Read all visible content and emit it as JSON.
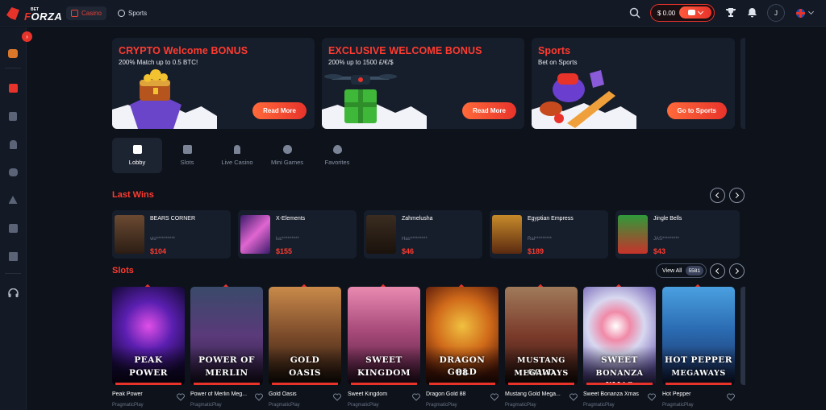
{
  "brand": {
    "bet": "BET",
    "name_a": "F",
    "name_b": "ORZA"
  },
  "nav": {
    "casino": "Casino",
    "sports": "Sports"
  },
  "header": {
    "balance": "$ 0.00",
    "avatar": "J"
  },
  "banners": [
    {
      "title": "CRYPTO Welcome BONUS",
      "subtitle": "200% Match up to 0.5 BTC!",
      "button": "Read More"
    },
    {
      "title": "EXCLUSIVE WELCOME BONUS",
      "subtitle": "200% up to 1500 £/€/$",
      "button": "Read More"
    },
    {
      "title": "Sports",
      "subtitle": "Bet on Sports",
      "button": "Go to Sports"
    }
  ],
  "categories": [
    "Lobby",
    "Slots",
    "Live Casino",
    "Mini Games",
    "Favorites"
  ],
  "last_wins": {
    "title": "Last Wins",
    "items": [
      {
        "game": "BEARS CORNER",
        "user": "vio**********",
        "amount": "$104"
      },
      {
        "game": "X-Elements",
        "user": "luc*********",
        "amount": "$155"
      },
      {
        "game": "Zahmelusha",
        "user": "Has*********",
        "amount": "$46"
      },
      {
        "game": "Egyptian Empress",
        "user": "Ral*********",
        "amount": "$189"
      },
      {
        "game": "Jingle Bells",
        "user": "JAS*********",
        "amount": "$43"
      }
    ]
  },
  "slots": {
    "title": "Slots",
    "view_all": "View All",
    "count": "5581",
    "items": [
      {
        "name": "Peak Power",
        "provider": "PragmaticPlay",
        "logo": [
          "PEAK",
          "POWER"
        ]
      },
      {
        "name": "Power of Merlin Meg...",
        "provider": "PragmaticPlay",
        "logo": [
          "POWER OF",
          "MERLIN"
        ]
      },
      {
        "name": "Gold Oasis",
        "provider": "PragmaticPlay",
        "logo": [
          "GOLD",
          "OASIS"
        ]
      },
      {
        "name": "Sweet Kingdom",
        "provider": "PragmaticPlay",
        "logo": [
          "SWEET",
          "KINGDOM"
        ]
      },
      {
        "name": "Dragon Gold 88",
        "provider": "PragmaticPlay",
        "logo": [
          "DRAGON GOLD",
          "88"
        ]
      },
      {
        "name": "Mustang Gold Mega...",
        "provider": "PragmaticPlay",
        "logo": [
          "MUSTANG GOLD",
          "MEGAWAYS"
        ]
      },
      {
        "name": "Sweet Bonanza Xmas",
        "provider": "PragmaticPlay",
        "logo": [
          "SWEET",
          "BONANZA XMAS"
        ]
      },
      {
        "name": "Hot Pepper",
        "provider": "PragmaticPlay",
        "logo": [
          "HOT PEPPER",
          "MEGAWAYS"
        ]
      }
    ]
  },
  "colors": {
    "accent": "#e8332b",
    "bg": "#0d121b",
    "panel": "#171e2b"
  }
}
